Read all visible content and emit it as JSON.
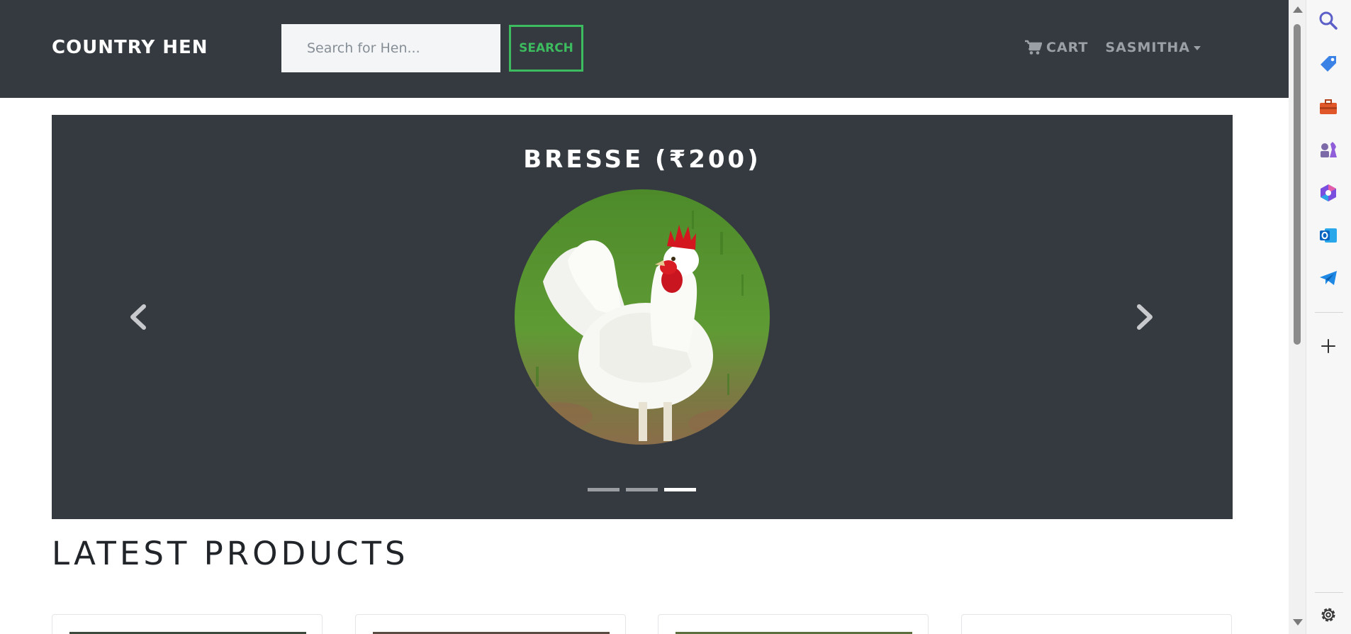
{
  "navbar": {
    "brand": "COUNTRY HEN",
    "search_placeholder": "Search for Hen...",
    "search_button": "SEARCH",
    "cart_label": "CART",
    "user_label": "SASMITHA"
  },
  "carousel": {
    "slide_title": "BRESSE (₹200)",
    "slides_count": 3,
    "active_slide": 3
  },
  "products": {
    "title": "LATEST PRODUCTS"
  },
  "edge_sidebar": {
    "icons": [
      "search-icon",
      "shopping-tag-icon",
      "tools-icon",
      "chess-icon",
      "copilot-icon",
      "outlook-icon",
      "telegram-icon",
      "add-icon",
      "settings-icon"
    ]
  },
  "colors": {
    "navbar_bg": "#343a40",
    "accent_green": "#3dbb5f",
    "nav_text": "#9aa0a6"
  }
}
